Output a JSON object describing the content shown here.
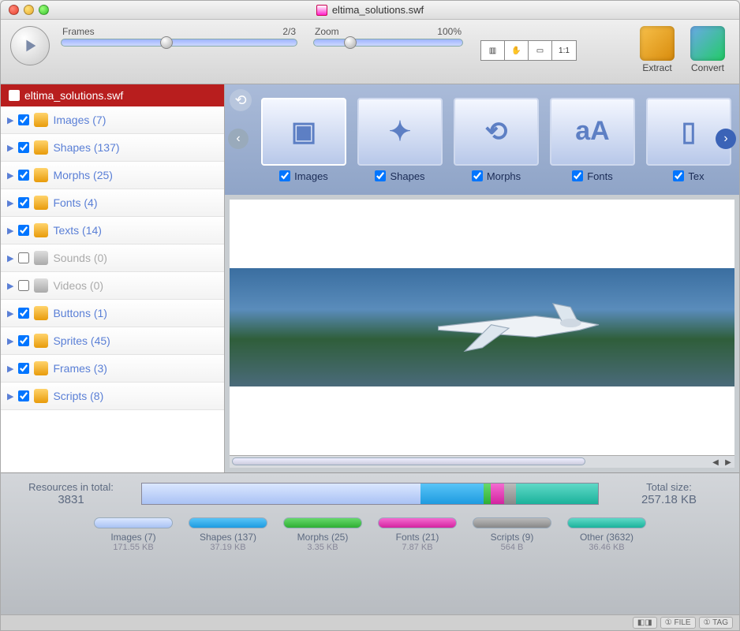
{
  "window_title": "eltima_solutions.swf",
  "toolbar": {
    "frames_label": "Frames",
    "frames_value": "2/3",
    "zoom_label": "Zoom",
    "zoom_value": "100%",
    "view_modes": [
      "▥",
      "✋",
      "▭",
      "1:1"
    ],
    "extract_label": "Extract",
    "convert_label": "Convert"
  },
  "sidebar": {
    "file": "eltima_solutions.swf",
    "items": [
      {
        "label": "Images",
        "count": 7,
        "checked": true,
        "enabled": true
      },
      {
        "label": "Shapes",
        "count": 137,
        "checked": true,
        "enabled": true
      },
      {
        "label": "Morphs",
        "count": 25,
        "checked": true,
        "enabled": true
      },
      {
        "label": "Fonts",
        "count": 4,
        "checked": true,
        "enabled": true
      },
      {
        "label": "Texts",
        "count": 14,
        "checked": true,
        "enabled": true
      },
      {
        "label": "Sounds",
        "count": 0,
        "checked": false,
        "enabled": false
      },
      {
        "label": "Videos",
        "count": 0,
        "checked": false,
        "enabled": false
      },
      {
        "label": "Buttons",
        "count": 1,
        "checked": true,
        "enabled": true
      },
      {
        "label": "Sprites",
        "count": 45,
        "checked": true,
        "enabled": true
      },
      {
        "label": "Frames",
        "count": 3,
        "checked": true,
        "enabled": true
      },
      {
        "label": "Scripts",
        "count": 8,
        "checked": true,
        "enabled": true
      }
    ]
  },
  "categories": [
    {
      "label": "Images",
      "glyph": "▣",
      "checked": true,
      "selected": true
    },
    {
      "label": "Shapes",
      "glyph": "✦",
      "checked": true,
      "selected": false
    },
    {
      "label": "Morphs",
      "glyph": "⟲",
      "checked": true,
      "selected": false
    },
    {
      "label": "Fonts",
      "glyph": "aA",
      "checked": true,
      "selected": false
    },
    {
      "label": "Tex",
      "glyph": "▯",
      "checked": true,
      "selected": false
    }
  ],
  "footer": {
    "res_label": "Resources in total:",
    "res_count": "3831",
    "total_label": "Total size:",
    "total_size": "257.18 KB",
    "segments": [
      {
        "key": "s-img",
        "pct": 61
      },
      {
        "key": "s-shp",
        "pct": 14
      },
      {
        "key": "s-mor",
        "pct": 1.5
      },
      {
        "key": "s-fnt",
        "pct": 3
      },
      {
        "key": "s-scr",
        "pct": 2.5
      },
      {
        "key": "s-oth",
        "pct": 18
      }
    ],
    "legend": [
      {
        "label": "Images (7)",
        "size": "171.55 KB",
        "cls": "s-img"
      },
      {
        "label": "Shapes (137)",
        "size": "37.19 KB",
        "cls": "s-shp"
      },
      {
        "label": "Morphs (25)",
        "size": "3.35 KB",
        "cls": "s-mor"
      },
      {
        "label": "Fonts (21)",
        "size": "7.87 KB",
        "cls": "s-fnt"
      },
      {
        "label": "Scripts (9)",
        "size": "564 B",
        "cls": "s-scr"
      },
      {
        "label": "Other (3632)",
        "size": "36.46 KB",
        "cls": "s-oth"
      }
    ]
  },
  "statusbar": [
    "◧◨",
    "① FILE",
    "① TAG"
  ]
}
